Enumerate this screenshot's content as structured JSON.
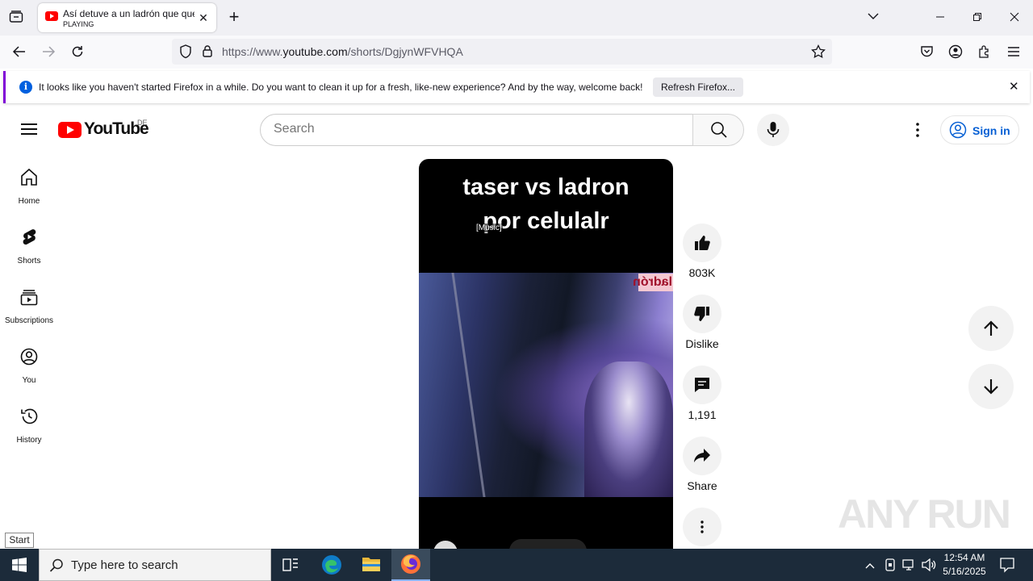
{
  "browser": {
    "tab_title": "Así detuve a un ladrón que que",
    "tab_status": "PLAYING",
    "url_prefix": "https://www.",
    "url_domain": "youtube.com",
    "url_path": "/shorts/DgjynWFVHQA",
    "notification_text": "It looks like you haven't started Firefox in a while. Do you want to clean it up for a fresh, like-new experience? And by the way, welcome back!",
    "notification_button": "Refresh Firefox..."
  },
  "youtube": {
    "logo_text": "YouTube",
    "country_code": "DE",
    "search_placeholder": "Search",
    "sign_in": "Sign in",
    "sidebar": [
      {
        "label": "Home",
        "icon": "home-icon"
      },
      {
        "label": "Shorts",
        "icon": "shorts-icon"
      },
      {
        "label": "Subscriptions",
        "icon": "subscriptions-icon"
      },
      {
        "label": "You",
        "icon": "you-icon"
      },
      {
        "label": "History",
        "icon": "history-icon"
      }
    ],
    "video": {
      "caption_line1": "taser vs ladron",
      "caption_line2": "por celulalr",
      "subtitle": "[Music]",
      "sticker": "ladrón"
    },
    "actions": {
      "likes": "803K",
      "dislike": "Dislike",
      "comments": "1,191",
      "share": "Share"
    }
  },
  "desktop": {
    "start_tooltip": "Start",
    "taskbar_search": "Type here to search",
    "time": "12:54 AM",
    "date": "5/16/2025",
    "watermark": "ANY RUN"
  },
  "colors": {
    "youtube_red": "#ff0000",
    "link_blue": "#065fd4",
    "firefox_purple": "#8000d7",
    "taskbar": "#1c2b3a"
  }
}
